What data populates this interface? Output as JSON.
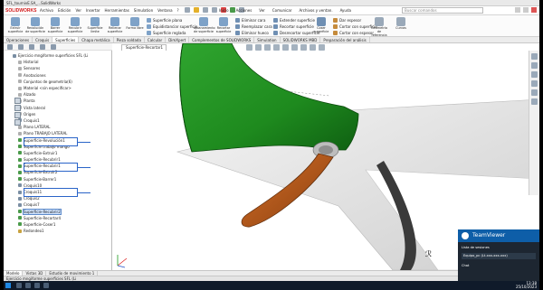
{
  "window": {
    "title": "SFL_tournivE.SA_...SolidWorks"
  },
  "menubar": {
    "logo_text": "SOLIDWORKS",
    "items": [
      "Archivo",
      "Edición",
      "Ver",
      "Insertar",
      "Herramientas",
      "Simulation",
      "Ventana",
      "?"
    ],
    "right_items": [
      "Inicio",
      "Acciones",
      "Ver",
      "Comunicar",
      "Archivos y ventan.",
      "Ayuda"
    ],
    "search_placeholder": "Buscar comandos"
  },
  "ribbon": {
    "large_buttons": [
      {
        "label": "Extruir superficie",
        "color": "#7ea2c8"
      },
      {
        "label": "Revolución de superficie",
        "color": "#7ea2c8"
      },
      {
        "label": "Barrer superficie",
        "color": "#7ea2c8"
      },
      {
        "label": "Recubrir superficie",
        "color": "#7ea2c8"
      },
      {
        "label": "Superficie límite",
        "color": "#7ea2c8"
      },
      {
        "label": "Rellenar superficie",
        "color": "#7ea2c8"
      },
      {
        "label": "Forma libre",
        "color": "#7ea2c8"
      }
    ],
    "small_group1": [
      "Superficie plana",
      "Equidistanciar superficie",
      "Superficie reglada"
    ],
    "aplanar_label": "Aplanamiento de superficie",
    "recortar_label": "Recortar superficie",
    "small_group2": [
      "Eliminar cara",
      "Reemplazar cara",
      "Eliminar hueco"
    ],
    "small_group3": [
      "Extender superficie",
      "Recortar superficie",
      "Desrecortar superficie"
    ],
    "coser_label": "Coser superficie",
    "small_group4": [
      "Dar espesor",
      "Cortar con superficie",
      "Cortar con espesor"
    ],
    "geom_label": "Geometría de referencia",
    "curvas_label": "Curvas"
  },
  "command_tabs": [
    "Operaciones",
    "Croquis",
    "Superficies",
    "Chapa metálica",
    "Pieza soldada",
    "Calcular",
    "DimXpert",
    "Complementos de SOLIDWORKS",
    "Simulation",
    "SOLIDWORKS MBD",
    "Preparación del análisis"
  ],
  "active_command_tab": "Superficies",
  "feature_tree": {
    "rows": [
      {
        "label": "Ejercicio mngiforme superficies SFL (Li",
        "icon": "part"
      },
      {
        "label": "Historial",
        "icon": "folder"
      },
      {
        "label": "Sensores",
        "icon": "folder"
      },
      {
        "label": "Anotaciones",
        "icon": "folder"
      },
      {
        "label": "Conjuntos de geometría(6)",
        "icon": "folder"
      },
      {
        "label": "Material <sin especificar>",
        "icon": "folder"
      },
      {
        "label": "Alzado",
        "icon": "plane"
      },
      {
        "label": "Planta",
        "icon": "plane"
      },
      {
        "label": "Vista lateral",
        "icon": "plane"
      },
      {
        "label": "Origen",
        "icon": "plane"
      },
      {
        "label": "Croquis1",
        "icon": "sketch"
      },
      {
        "label": "Plano LATERAL",
        "icon": "plane"
      },
      {
        "label": "Plano TRABAJO LATERAL",
        "icon": "plane"
      },
      {
        "label": "Superficie-Revolución1",
        "icon": "surface"
      },
      {
        "label": "Superficie trabajo mango",
        "icon": "surface"
      },
      {
        "label": "Superficie-Extruir1",
        "icon": "surface"
      },
      {
        "label": "Superficie-Recubrir1",
        "icon": "surface"
      },
      {
        "label": "Superficie-Recubrir1",
        "icon": "surface"
      },
      {
        "label": "Superficie-Extruir2",
        "icon": "surface"
      },
      {
        "label": "Superficie-Barrer1",
        "icon": "surface"
      },
      {
        "label": "Croquis10",
        "icon": "sketch"
      },
      {
        "label": "Croquis11",
        "icon": "sketch"
      },
      {
        "label": "Croquis2",
        "icon": "sketch"
      },
      {
        "label": "Croquis7",
        "icon": "sketch"
      },
      {
        "label": "Superficie-Recubrir2",
        "icon": "surface",
        "selected": true
      },
      {
        "label": "Superficie-Recortar4",
        "icon": "surface"
      },
      {
        "label": "Superficie-Coser1",
        "icon": "surface"
      },
      {
        "label": "Redondeo1",
        "icon": "fillet"
      }
    ]
  },
  "viewport": {
    "tab_label": "Superficie-Recortar1"
  },
  "bottom_tabs": [
    "Modelo",
    "Vistas 3D",
    "Estudio de movimiento 1"
  ],
  "active_bottom_tab": "Modelo",
  "status_text": "Ejercicio mngiforme superficies SFL (Li",
  "teamviewer": {
    "title": "TeamViewer",
    "section": "Lista de sesiones",
    "session": "Equipo_pc (Lt-xxx-xxx-xxx)",
    "chat": "Chat",
    "accent": "#0e5ea8"
  },
  "taskbar": {
    "time": "13:38",
    "date": "25/10/2023"
  },
  "model_colors": {
    "blade": "#1e8a1e",
    "handle": "#b8581a",
    "body": "#e6e6e6"
  }
}
